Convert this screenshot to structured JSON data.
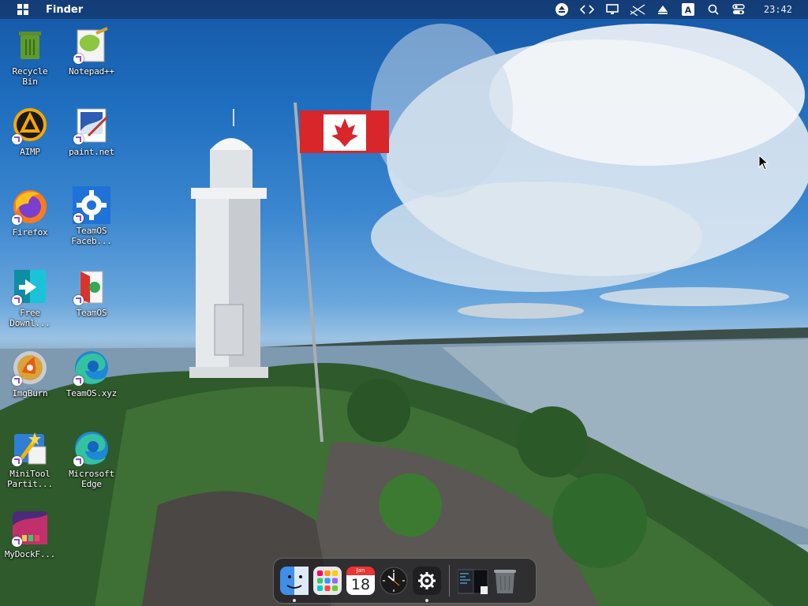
{
  "topbar": {
    "app_name": "Finder",
    "clock": "23:42",
    "tray_icons": [
      "eject-icon",
      "code-brackets-icon",
      "monitor-icon",
      "network-disconnected-icon",
      "upload-icon",
      "keyboard-layout-icon",
      "search-icon",
      "control-center-icon"
    ],
    "keyboard_letter": "A"
  },
  "desktop": {
    "icons": [
      {
        "label": "Recycle\nBin",
        "icon": "recycle-bin-icon"
      },
      {
        "label": "Notepad++",
        "icon": "notepad-plus-plus-icon"
      },
      {
        "label": "AIMP",
        "icon": "aimp-icon"
      },
      {
        "label": "paint.net",
        "icon": "paint-net-icon"
      },
      {
        "label": "Firefox",
        "icon": "firefox-icon"
      },
      {
        "label": "TeamOS\nFaceb...",
        "icon": "teamos-facebook-icon"
      },
      {
        "label": "Free\nDownl...",
        "icon": "free-download-manager-icon"
      },
      {
        "label": "TeamOS",
        "icon": "teamos-icon"
      },
      {
        "label": "ImgBurn",
        "icon": "imgburn-icon"
      },
      {
        "label": "TeamOS.xyz",
        "icon": "edge-teamos-icon"
      },
      {
        "label": "MiniTool\nPartit...",
        "icon": "minitool-partition-icon"
      },
      {
        "label": "Microsoft\nEdge",
        "icon": "edge-icon"
      },
      {
        "label": "MyDockF...",
        "icon": "mydockfinder-icon"
      }
    ]
  },
  "dock": {
    "items": [
      "finder-icon",
      "launchpad-icon",
      "calendar-icon",
      "clock-icon",
      "settings-icon",
      "terminal-preview-icon",
      "trash-icon"
    ],
    "calendar_month": "Jan",
    "calendar_day": "18"
  },
  "colors": {
    "topbar_bg": "#14284f",
    "accent": "#8a4bd6",
    "flag_red": "#d8262b"
  }
}
